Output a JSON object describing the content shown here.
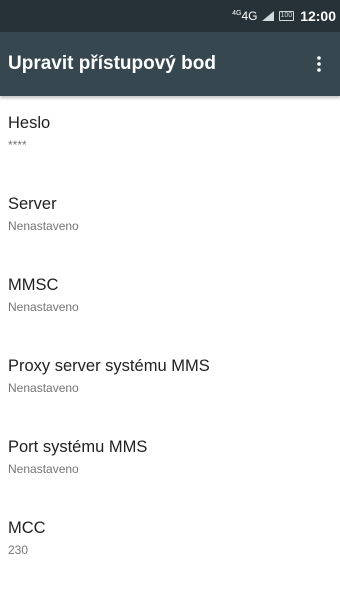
{
  "status_bar": {
    "network": "4G",
    "network_prefix": "4G",
    "battery": "100",
    "time": "12:00",
    "icons": [
      "signal-icon",
      "battery-icon"
    ]
  },
  "app_bar": {
    "title": "Upravit přístupový bod",
    "overflow_icon": "more-vert-icon"
  },
  "colors": {
    "status_bar_bg": "#263238",
    "app_bar_bg": "#37474f",
    "title_text": "#ffffff",
    "item_title": "#212121",
    "item_summary": "#757575"
  },
  "items": [
    {
      "title": "Heslo",
      "summary": "****"
    },
    {
      "title": "Server",
      "summary": "Nenastaveno"
    },
    {
      "title": "MMSC",
      "summary": "Nenastaveno"
    },
    {
      "title": "Proxy server systému MMS",
      "summary": "Nenastaveno"
    },
    {
      "title": "Port systému MMS",
      "summary": "Nenastaveno"
    },
    {
      "title": "MCC",
      "summary": "230"
    }
  ]
}
